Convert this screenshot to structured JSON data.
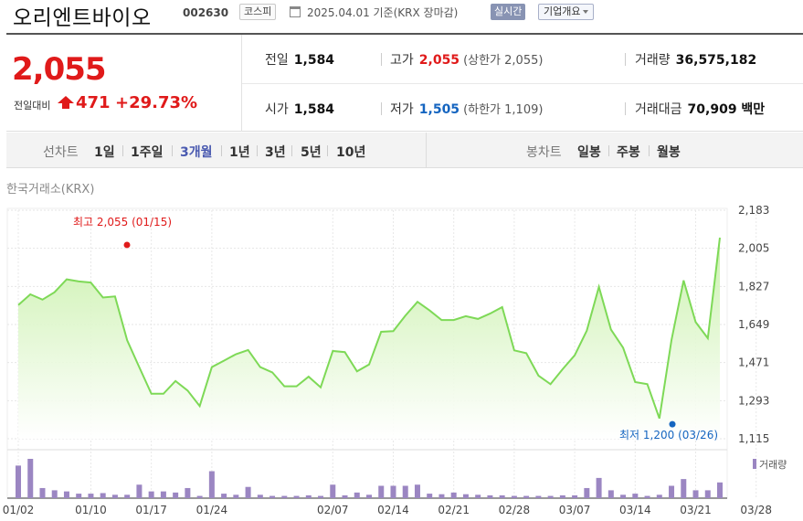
{
  "header": {
    "company_name": "오리엔트바이오",
    "code": "002630",
    "market": "코스피",
    "date_text": "2025.04.01  기준(KRX 장마감)",
    "live_label": "실시간",
    "overview_label": "기업개요"
  },
  "quote": {
    "price": "2,055",
    "change_label": "전일대비",
    "change": "471",
    "change_pct": "+29.73%",
    "prev_label": "전일",
    "prev": "1,584",
    "high_label": "고가",
    "high": "2,055",
    "upper_limit": "(상한가 2,055)",
    "volume_label": "거래량",
    "volume": "36,575,182",
    "open_label": "시가",
    "open": "1,584",
    "low_label": "저가",
    "low": "1,505",
    "lower_limit": "(하한가 1,109)",
    "amount_label": "거래대금",
    "amount": "70,909 백만"
  },
  "tabs": {
    "line_label": "선차트",
    "line_items": [
      "1일",
      "1주일",
      "3개월",
      "1년",
      "3년",
      "5년",
      "10년"
    ],
    "active": "3개월",
    "candle_label": "봉차트",
    "candle_items": [
      "일봉",
      "주봉",
      "월봉"
    ]
  },
  "exchange_label": "한국거래소(KRX)",
  "colors": {
    "up": "#e01a1a",
    "down": "#1565c0",
    "line": "#7ed957",
    "fill_top": "#c6f0a6",
    "volume_bar": "#9b86c2",
    "active_tab": "#4a5ab0"
  },
  "chart_data": {
    "type": "area",
    "y_ticks": [
      "2,183",
      "2,005",
      "1,827",
      "1,649",
      "1,471",
      "1,293",
      "1,115"
    ],
    "ylim": [
      1115,
      2183
    ],
    "x_labels": [
      "01/02",
      "01/10",
      "01/17",
      "01/24",
      "02/07",
      "02/14",
      "02/21",
      "02/28",
      "03/07",
      "03/14",
      "03/21",
      "03/28"
    ],
    "x_label_index": [
      0,
      6,
      11,
      16,
      26,
      31,
      36,
      41,
      46,
      51,
      56,
      61
    ],
    "values": [
      1740,
      1790,
      1765,
      1800,
      1860,
      1850,
      1845,
      1775,
      1780,
      1575,
      1450,
      1325,
      1325,
      1385,
      1340,
      1268,
      1450,
      1480,
      1510,
      1530,
      1450,
      1425,
      1360,
      1360,
      1405,
      1355,
      1525,
      1520,
      1430,
      1462,
      1615,
      1618,
      1690,
      1755,
      1715,
      1670,
      1670,
      1688,
      1675,
      1700,
      1730,
      1528,
      1515,
      1410,
      1370,
      1440,
      1505,
      1620,
      1825,
      1625,
      1540,
      1380,
      1370,
      1210,
      1575,
      1855,
      1660,
      1585,
      2055
    ],
    "volume_legend": "거래량",
    "volume": [
      58,
      70,
      18,
      14,
      12,
      8,
      8,
      9,
      6,
      6,
      24,
      12,
      12,
      10,
      18,
      4,
      48,
      8,
      6,
      20,
      6,
      4,
      4,
      4,
      5,
      4,
      24,
      5,
      10,
      6,
      22,
      22,
      22,
      24,
      8,
      7,
      10,
      7,
      6,
      5,
      5,
      4,
      4,
      4,
      4,
      5,
      5,
      18,
      36,
      14,
      6,
      8,
      4,
      6,
      22,
      34,
      14,
      14,
      28
    ],
    "annotations": [
      {
        "text": "최고 2,055 (01/15)",
        "x_index": 13,
        "y": 2055
      },
      {
        "text": "최저 1,200 (03/26)",
        "x_index": 53,
        "y": 1200
      }
    ]
  }
}
